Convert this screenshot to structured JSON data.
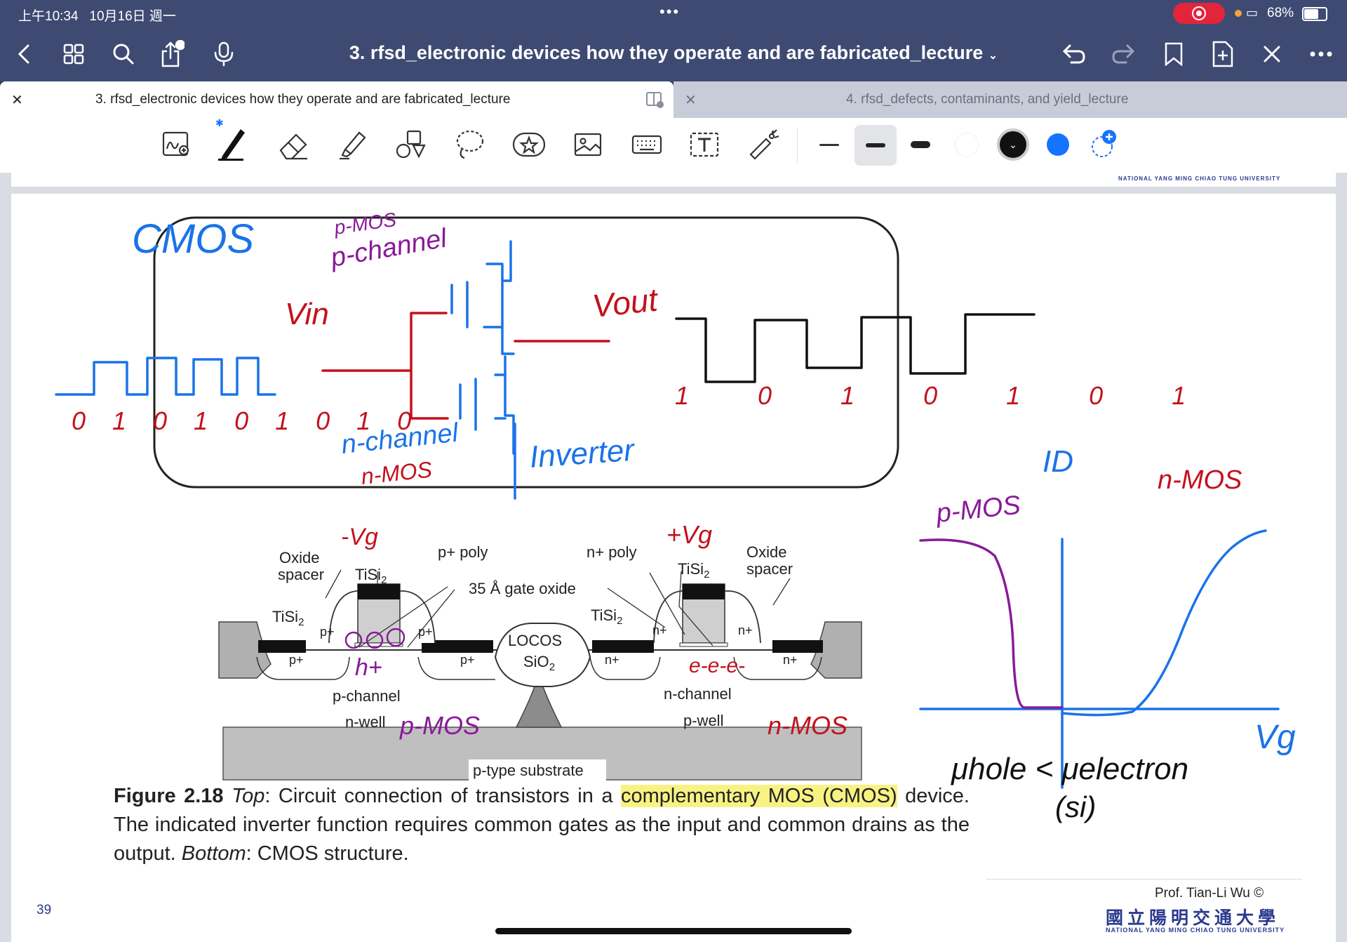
{
  "status_bar": {
    "time": "上午10:34",
    "date": "10月16日 週一",
    "battery_pct": "68%",
    "battery_level": 0.68
  },
  "nav": {
    "doc_title": "3. rfsd_electronic devices how they operate and are fabricated_lecture",
    "icons": [
      "back-icon",
      "grid-icon",
      "search-icon",
      "share-icon",
      "mic-icon",
      "undo-icon",
      "redo-icon",
      "bookmark-icon",
      "add-page-icon",
      "close-tools-icon",
      "more-icon"
    ]
  },
  "tabs": [
    {
      "label": "3. rfsd_electronic devices how they operate and are fabricated_lecture",
      "active": true
    },
    {
      "label": "4. rfsd_defects, contaminants, and yield_lecture",
      "active": false
    }
  ],
  "toolbar": {
    "tools": [
      "zoom-write-icon",
      "pen-icon",
      "eraser-icon",
      "highlighter-icon",
      "shapes-icon",
      "lasso-icon",
      "sticker-icon",
      "image-icon",
      "keyboard-icon",
      "text-box-icon",
      "laser-pointer-icon"
    ],
    "colors": [
      "#ffffff",
      "#111111",
      "#1673ff"
    ]
  },
  "slide": {
    "header_uni_en": "NATIONAL YANG MING CHIAO TUNG UNIVERSITY",
    "diagram_labels": {
      "oxide_spacer_left": [
        "Oxide",
        "spacer"
      ],
      "tisi2_left": "TiSi2",
      "p_poly": "p+ poly",
      "n_poly": "n+ poly",
      "gate_oxide": "35 Å gate oxide",
      "locos": [
        "LOCOS",
        "SiO2"
      ],
      "tisi2_right": "TiSi2",
      "oxide_spacer_right": [
        "Oxide",
        "spacer"
      ],
      "p_channel": "p-channel",
      "n_well": "n-well",
      "n_channel": "n-channel",
      "p_well": "p-well",
      "substrate": "p-type substrate",
      "pplus": "p+",
      "nplus": "n+"
    },
    "caption": {
      "fig": "Figure 2.18",
      "top_label": "Top",
      "part1": ": Circuit connection of transistors in a ",
      "highlighted": "complementary MOS (CMOS)",
      "part2": " device. The indicated inverter function requires common gates as the input and common drains as the output. ",
      "bottom_label": "Bottom",
      "part3": ": CMOS structure."
    },
    "footer": {
      "prof": "Prof. Tian-Li Wu ©",
      "uni_cn": "國立陽明交通大學",
      "uni_en": "NATIONAL YANG MING CHIAO TUNG UNIVERSITY",
      "page_number": "39"
    }
  },
  "annotations": {
    "cmos": "CMOS",
    "pmos_top": "p-MOS",
    "p_channel": "p-channel",
    "vin": "Vin",
    "vout": "Vout",
    "n_channel": "n-channel",
    "n_mos": "n-MOS",
    "inverter": "Inverter",
    "input_bits": "0 1 0 1 0 1 0 1 0",
    "output_bits": "1 0 1 0 1 0 1",
    "minus_vg": "-Vg",
    "plus_vg": "+Vg",
    "h_plus": "h+",
    "e_minus": "e-e-e-",
    "pmos_label": "p-MOS",
    "nmos_label": "n-MOS",
    "graph_pmos": "p-MOS",
    "graph_nmos": "n-MOS",
    "id": "ID",
    "vg": "Vg",
    "mobility": "μhole < μelectron",
    "si": "(si)"
  }
}
